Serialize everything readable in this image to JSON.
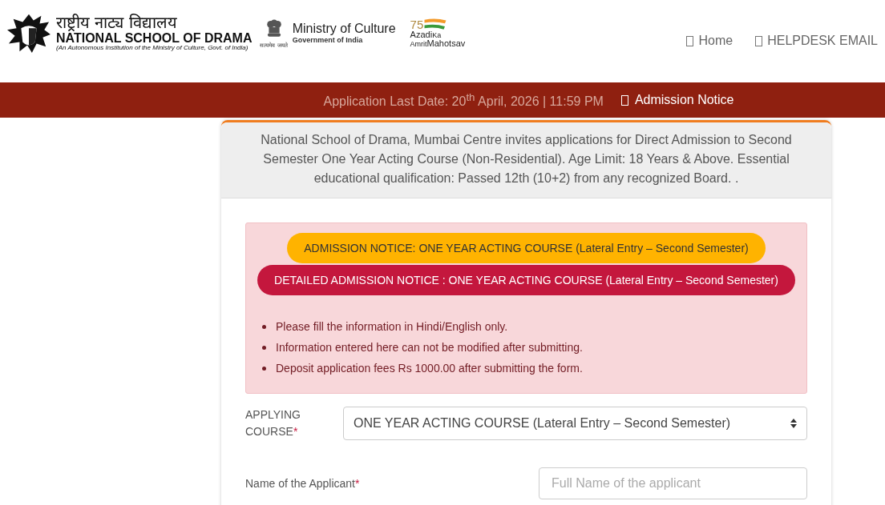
{
  "header": {
    "nsd_logo": {
      "hindi": "राष्ट्रीय नाट्य विद्यालय",
      "name": "NATIONAL SCHOOL OF DRAMA",
      "subtitle": "(An Autonomous Institution of the Ministry of Culture, Govt. of India)"
    },
    "ministry_logo": {
      "motto": "सत्यमेव जयते",
      "title": "Ministry of Culture",
      "subtitle": "Government of India"
    },
    "azadi_logo": {
      "number": "75",
      "line1": "Azadi",
      "ka": "Ka",
      "amrit": "Amrit",
      "mahotsav": "Mahotsav"
    },
    "nav": [
      {
        "label": "Home"
      },
      {
        "label": "HELPDESK EMAIL"
      }
    ]
  },
  "notice_bar": {
    "last_date": "Application Last Date: 20$^{th}$ April, 2026 | 11:59 PM",
    "link": "Admission Notice"
  },
  "card": {
    "intro": "National School of Drama, Mumbai Centre invites applications for Direct Admission to Second Semester One Year Acting Course (Non-Residential). Age Limit: 18 Years & Above. Essential educational qualification: Passed 12th (10+2) from any recognized Board. .",
    "alert": {
      "buttons": [
        {
          "kind": "warning",
          "label": "ADMISSION NOTICE: ONE YEAR ACTING COURSE (Lateral Entry – Second Semester)"
        },
        {
          "kind": "danger",
          "label": "DETAILED ADMISSION NOTICE : ONE YEAR ACTING COURSE (Lateral Entry – Second Semester)"
        }
      ],
      "points": [
        "Please fill the information in Hindi/English only.",
        "Information entered here can not be modified after submitting.",
        "Deposit application fees Rs 1000.00 after submitting the form."
      ]
    },
    "fields": [
      {
        "kind": "select",
        "label": "APPLYING COURSE",
        "required_mark": "*",
        "value": "ONE YEAR ACTING COURSE (Lateral Entry – Second Semester)"
      },
      {
        "kind": "text",
        "label": "Name of the Applicant",
        "required_mark": "*",
        "placeholder": "Full Name of the applicant"
      }
    ]
  }
}
